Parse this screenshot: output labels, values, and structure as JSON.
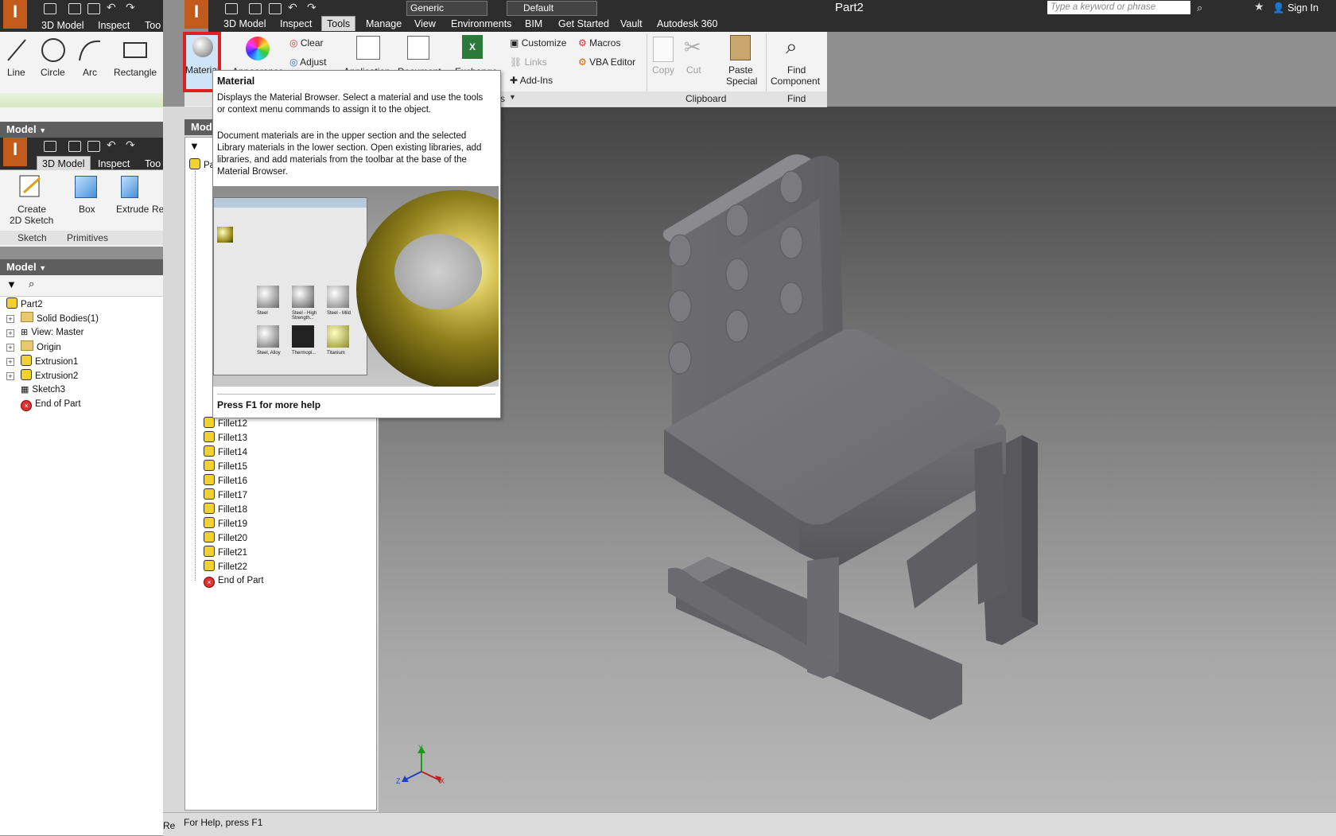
{
  "window": {
    "title": "Part2",
    "search_placeholder": "Type a keyword or phrase",
    "sign_in": "Sign In",
    "style_value": "Generic",
    "appearance_value": "Default"
  },
  "main_tabs": [
    "3D Model",
    "Inspect",
    "Tools",
    "Manage",
    "View",
    "Environments",
    "BIM",
    "Get Started",
    "Vault",
    "Autodesk 360"
  ],
  "tools_ribbon": {
    "material": "Material",
    "appearance": "Appearance",
    "clear": "Clear",
    "adjust": "Adjust",
    "application": "Application",
    "document": "Document",
    "exchange": "Exchange",
    "customize": "Customize",
    "links": "Links",
    "addins": "Add-Ins",
    "macros": "Macros",
    "vba_editor": "VBA Editor",
    "copy": "Copy",
    "cut": "Cut",
    "paste_special_1": "Paste",
    "paste_special_2": "Special",
    "find_component_1": "Find",
    "find_component_2": "Component",
    "panel_clipboard": "Clipboard",
    "panel_find": "Find",
    "panel_options_tail": "s"
  },
  "tooltip": {
    "title": "Material",
    "para1": "Displays the Material Browser. Select a material and use the tools or context menu commands to assign it to the object.",
    "para2": "Document materials are in the upper section and the selected Library materials in the lower section. Open existing libraries, add libraries, and add materials from the toolbar at the base of the Material Browser.",
    "footer": "Press F1 for more help",
    "preview_items": [
      "Steel",
      "Steel - High Strength...",
      "Steel - Mild",
      "Steel, Alloy",
      "Thermopl...",
      "Titanium"
    ]
  },
  "left_window_1": {
    "tabs": [
      "3D Model",
      "Inspect",
      "Too"
    ],
    "tools": [
      "Line",
      "Circle",
      "Arc",
      "Rectangle"
    ],
    "model_header": "Model"
  },
  "left_window_2": {
    "tabs": [
      "3D Model",
      "Inspect",
      "Too"
    ],
    "tools": {
      "create": "Create",
      "sketch2d": "2D Sketch",
      "box": "Box",
      "extrude": "Extrude",
      "re": "Re"
    },
    "panels": [
      "Sketch",
      "Primitives"
    ],
    "model_header": "Model",
    "tree": [
      "Part2",
      "Solid Bodies(1)",
      "View: Master",
      "Origin",
      "Extrusion1",
      "Extrusion2",
      "Sketch3",
      "End of Part"
    ]
  },
  "main_browser": {
    "header": "Mod",
    "top_item": "Pa",
    "fillets": [
      "Fillet12",
      "Fillet13",
      "Fillet14",
      "Fillet15",
      "Fillet16",
      "Fillet17",
      "Fillet18",
      "Fillet19",
      "Fillet20",
      "Fillet21",
      "Fillet22"
    ],
    "end": "End of Part"
  },
  "status": {
    "text": "For Help, press F1",
    "left_fragment": "Re"
  },
  "axis": {
    "x": "X",
    "y": "Y",
    "z": "Z"
  },
  "colors": {
    "title_bar": "#2d2d2d",
    "ribbon": "#f3f3f3",
    "highlight": "#e02020",
    "viewport_top": "#4a4a4a",
    "viewport_bottom": "#b5b5b5"
  }
}
